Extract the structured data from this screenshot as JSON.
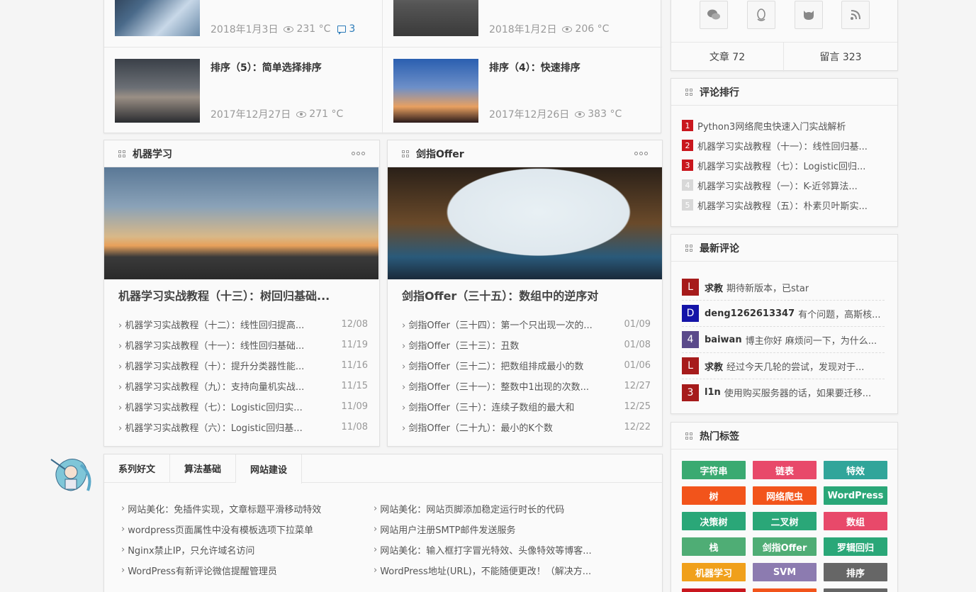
{
  "top_posts": [
    {
      "title": "",
      "date": "2018年1月3日",
      "views": "231 °C",
      "comments": "3"
    },
    {
      "title": "",
      "date": "2018年1月2日",
      "views": "206 °C"
    },
    {
      "title": "排序（5）：简单选择排序",
      "date": "2017年12月27日",
      "views": "271 °C"
    },
    {
      "title": "排序（4）：快速排序",
      "date": "2017年12月26日",
      "views": "383 °C"
    }
  ],
  "ml": {
    "header": "机器学习",
    "featured": "机器学习实战教程（十三）：树回归基础...",
    "items": [
      {
        "t": "机器学习实战教程（十二）：线性回归提高...",
        "d": "12/08"
      },
      {
        "t": "机器学习实战教程（十一）：线性回归基础...",
        "d": "11/19"
      },
      {
        "t": "机器学习实战教程（十）：提升分类器性能...",
        "d": "11/16"
      },
      {
        "t": "机器学习实战教程（九）：支持向量机实战...",
        "d": "11/15"
      },
      {
        "t": "机器学习实战教程（七）：Logistic回归实...",
        "d": "11/09"
      },
      {
        "t": "机器学习实战教程（六）：Logistic回归基...",
        "d": "11/08"
      }
    ]
  },
  "offer": {
    "header": "剑指Offer",
    "featured": "剑指Offer（三十五）：数组中的逆序对",
    "items": [
      {
        "t": "剑指Offer（三十四）：第一个只出现一次的...",
        "d": "01/09"
      },
      {
        "t": "剑指Offer（三十三）：丑数",
        "d": "01/08"
      },
      {
        "t": "剑指Offer（三十二）：把数组排成最小的数",
        "d": "01/06"
      },
      {
        "t": "剑指Offer（三十一）：整数中1出现的次数...",
        "d": "12/27"
      },
      {
        "t": "剑指Offer（三十）：连续子数组的最大和",
        "d": "12/25"
      },
      {
        "t": "剑指Offer（二十九）：最小的K个数",
        "d": "12/22"
      }
    ]
  },
  "tabs": {
    "labels": [
      "系列好文",
      "算法基础",
      "网站建设"
    ],
    "active": 2,
    "left": [
      "网站美化：免插件实现，文章标题平滑移动特效",
      "wordpress页面属性中没有模板选项下拉菜单",
      "Nginx禁止IP，只允许域名访问",
      "WordPress有新评论微信提醒管理员"
    ],
    "right": [
      "网站美化：网站页脚添加稳定运行时长的代码",
      "网站用户注册SMTP邮件发送服务",
      "网站美化：输入框打字冒光特效、头像特效等博客...",
      "WordPress地址(URL)，不能随便更改！（解决方..."
    ]
  },
  "sidebar": {
    "social_icons": [
      "wechat-icon",
      "qq-icon",
      "github-icon",
      "rss-icon"
    ],
    "stats": {
      "articles": "文章 72",
      "messages": "留言 323"
    },
    "rank": {
      "header": "评论排行",
      "items": [
        {
          "n": "1",
          "t": "Python3网络爬虫快速入门实战解析",
          "color": "#c9171e"
        },
        {
          "n": "2",
          "t": "机器学习实战教程（十一）：线性回归基...",
          "color": "#c9171e"
        },
        {
          "n": "3",
          "t": "机器学习实战教程（七）：Logistic回归...",
          "color": "#c9171e"
        },
        {
          "n": "4",
          "t": "机器学习实战教程（一）：K-近邻算法...",
          "color": "#d8d8d8"
        },
        {
          "n": "5",
          "t": "机器学习实战教程（五）：朴素贝叶斯实...",
          "color": "#d8d8d8"
        }
      ]
    },
    "comments": {
      "header": "最新评论",
      "items": [
        {
          "av": "L",
          "bg": "#a61b1b",
          "name": "求教",
          "text": "期待新版本，已star"
        },
        {
          "av": "D",
          "bg": "#1414a8",
          "name": "deng1262613347",
          "text": "有个问题，高斯核..."
        },
        {
          "av": "4",
          "bg": "#5a4a8a",
          "name": "baiwan",
          "text": "博主你好 麻烦问一下，为什么..."
        },
        {
          "av": "L",
          "bg": "#a61b1b",
          "name": "求教",
          "text": "经过今天几轮的尝试，发现对于..."
        },
        {
          "av": "3",
          "bg": "#a61b1b",
          "name": "l1n",
          "text": "使用购买服务器的话，如果要迁移..."
        }
      ]
    },
    "tags": {
      "header": "热门标签",
      "items": [
        {
          "t": "字符串",
          "c": "#3aaa71"
        },
        {
          "t": "链表",
          "c": "#e8496a"
        },
        {
          "t": "特效",
          "c": "#31a59a"
        },
        {
          "t": "树",
          "c": "#f2541b"
        },
        {
          "t": "网络爬虫",
          "c": "#f2541b"
        },
        {
          "t": "WordPress",
          "c": "#2aa778"
        },
        {
          "t": "决策树",
          "c": "#2aa778"
        },
        {
          "t": "二叉树",
          "c": "#2aa778"
        },
        {
          "t": "数组",
          "c": "#e8496a"
        },
        {
          "t": "栈",
          "c": "#4fad75"
        },
        {
          "t": "剑指Offer",
          "c": "#4fad75"
        },
        {
          "t": "罗辑回归",
          "c": "#2aa778"
        },
        {
          "t": "机器学习",
          "c": "#f0a01b"
        },
        {
          "t": "SVM",
          "c": "#8c7bb0"
        },
        {
          "t": "排序",
          "c": "#666666"
        }
      ]
    }
  }
}
